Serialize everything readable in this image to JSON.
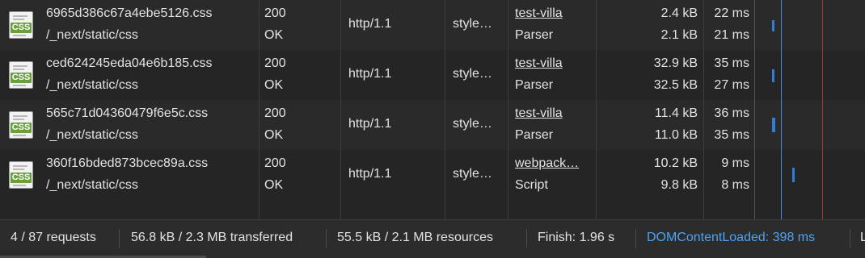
{
  "rows": [
    {
      "name": "6965d386c67a4ebe5126.css",
      "path": "/_next/static/css",
      "status": "200",
      "status_text": "OK",
      "protocol": "http/1.1",
      "type": "style…",
      "initiator": "test-villa",
      "initiator_type": "Parser",
      "size": "2.4 kB",
      "resource_size": "2.1 kB",
      "time": "22 ms",
      "latency": "21 ms",
      "icon": "css-file-icon"
    },
    {
      "name": "ced624245eda04e6b185.css",
      "path": "/_next/static/css",
      "status": "200",
      "status_text": "OK",
      "protocol": "http/1.1",
      "type": "style…",
      "initiator": "test-villa",
      "initiator_type": "Parser",
      "size": "32.9 kB",
      "resource_size": "32.5 kB",
      "time": "35 ms",
      "latency": "27 ms",
      "icon": "css-file-icon"
    },
    {
      "name": "565c71d04360479f6e5c.css",
      "path": "/_next/static/css",
      "status": "200",
      "status_text": "OK",
      "protocol": "http/1.1",
      "type": "style…",
      "initiator": "test-villa",
      "initiator_type": "Parser",
      "size": "11.4 kB",
      "resource_size": "11.0 kB",
      "time": "36 ms",
      "latency": "35 ms",
      "icon": "css-file-icon"
    },
    {
      "name": "360f16bded873bcec89a.css",
      "path": "/_next/static/css",
      "status": "200",
      "status_text": "OK",
      "protocol": "http/1.1",
      "type": "style…",
      "initiator": "webpack…",
      "initiator_type": "Script",
      "size": "10.2 kB",
      "resource_size": "9.8 kB",
      "time": "9 ms",
      "latency": "8 ms",
      "icon": "css-file-icon"
    }
  ],
  "icon_label": "CSS",
  "statusbar": {
    "requests": "4 / 87 requests",
    "transferred": "56.8 kB / 2.3 MB transferred",
    "resources": "55.5 kB / 2.1 MB resources",
    "finish": "Finish: 1.96 s",
    "dom_content_loaded": "DOMContentLoaded: 398 ms",
    "load_truncated": "L"
  },
  "colors": {
    "dom_content_loaded": "#4da3f4",
    "load_line": "#a13a3a",
    "waterfall_bar": "#2f7fd6",
    "css_badge": "#6aa03a"
  }
}
